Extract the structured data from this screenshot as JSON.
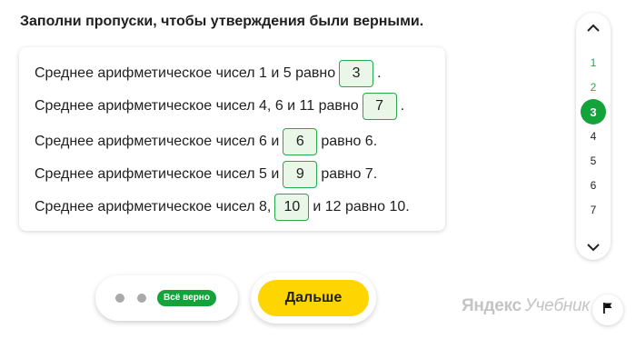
{
  "task": {
    "title": "Заполни пропуски, чтобы утверждения были верными.",
    "lines": [
      {
        "before": "Среднее арифметическое чисел 1 и 5 равно",
        "answer": "3",
        "after": "."
      },
      {
        "before": "Среднее арифметическое чисел 4, 6 и 11 равно",
        "answer": "7",
        "after": "."
      },
      {
        "before": "Среднее арифметическое чисел 6 и",
        "answer": "6",
        "after": "равно 6."
      },
      {
        "before": "Среднее арифметическое чисел 5 и",
        "answer": "9",
        "after": "равно 7."
      },
      {
        "before": "Среднее арифметическое чисел 8,",
        "answer": "10",
        "after": "и 12 равно 10."
      }
    ]
  },
  "nav": {
    "up_icon": "chevron-up-icon",
    "down_icon": "chevron-down-icon",
    "items": [
      "1",
      "2",
      "3",
      "4",
      "5",
      "6",
      "7"
    ],
    "active": "3",
    "done": [
      "1",
      "2"
    ]
  },
  "status": {
    "badge": "Всё верно",
    "dot_color": "#a9a9a9",
    "badge_color": "#14a33a"
  },
  "actions": {
    "next_label": "Дальше",
    "next_color": "#ffd500",
    "flag_icon": "flag-icon"
  },
  "brand": {
    "name": "Яндекс",
    "product": "Учебник"
  },
  "colors": {
    "accent_green": "#27a84a",
    "answer_bg": "#eaf6e8"
  }
}
